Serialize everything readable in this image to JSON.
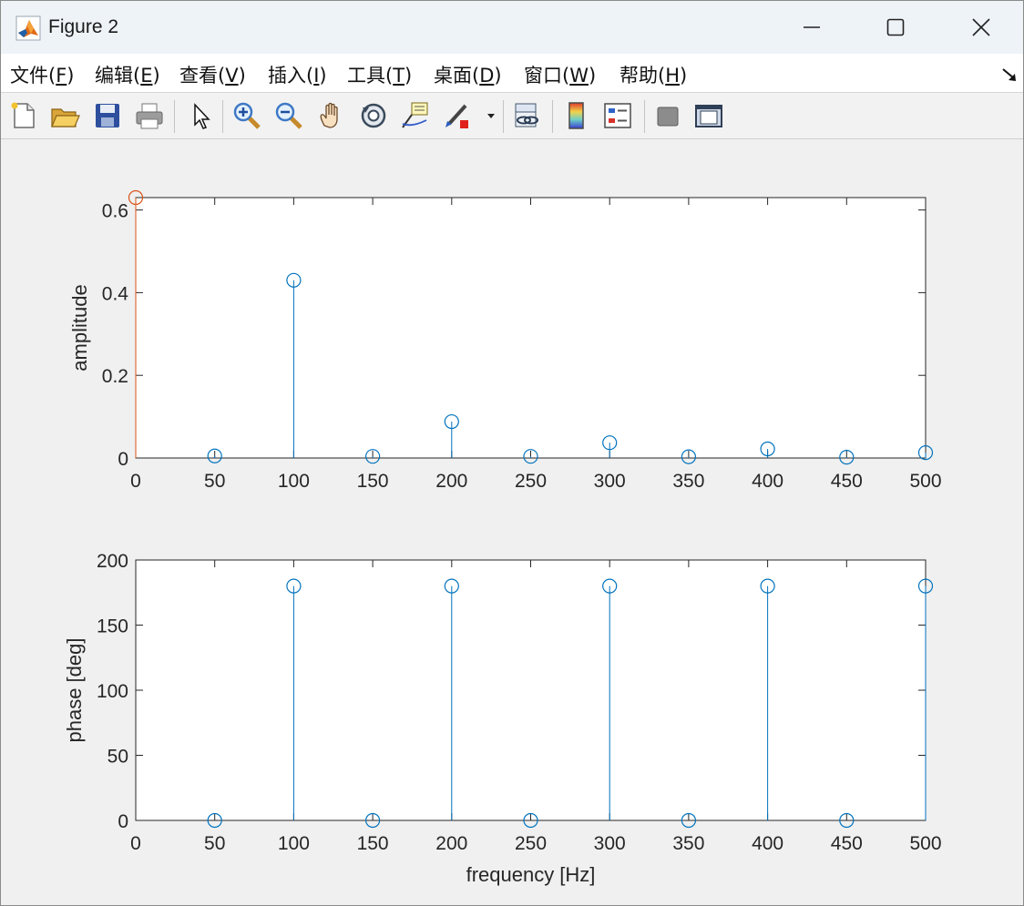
{
  "window": {
    "title": "Figure 2",
    "app_icon": "matlab-logo-icon",
    "controls": [
      "minimize-icon",
      "maximize-icon",
      "close-icon"
    ]
  },
  "menu": [
    {
      "label": "文件(",
      "mnemonic": "F",
      "suffix": ")"
    },
    {
      "label": "编辑(",
      "mnemonic": "E",
      "suffix": ")"
    },
    {
      "label": "查看(",
      "mnemonic": "V",
      "suffix": ")"
    },
    {
      "label": "插入(",
      "mnemonic": "I",
      "suffix": ")"
    },
    {
      "label": "工具(",
      "mnemonic": "T",
      "suffix": ")"
    },
    {
      "label": "桌面(",
      "mnemonic": "D",
      "suffix": ")"
    },
    {
      "label": "窗口(",
      "mnemonic": "W",
      "suffix": ")"
    },
    {
      "label": "帮助(",
      "mnemonic": "H",
      "suffix": ")"
    }
  ],
  "toolbar": [
    "new-figure-icon",
    "open-file-icon",
    "save-icon",
    "print-icon",
    "edit-plot-pointer-icon",
    "zoom-in-icon",
    "zoom-out-icon",
    "pan-hand-icon",
    "rotate-3d-icon",
    "data-cursor-icon",
    "brush-icon",
    "brush-dropdown-icon",
    "link-plot-icon",
    "insert-colorbar-icon",
    "insert-legend-icon",
    "hide-plot-tools-icon",
    "show-plot-tools-icon"
  ],
  "colors": {
    "stem_blue": "#0072BD",
    "stem_orange": "#D95319",
    "axes_bg": "#ffffff",
    "figure_bg": "#f0f0f0"
  },
  "chart_data": [
    {
      "type": "stem",
      "title": "",
      "xlabel": "",
      "ylabel": "amplitude",
      "xlim": [
        0,
        500
      ],
      "ylim": [
        0,
        0.63
      ],
      "xticks": [
        "0",
        "50",
        "100",
        "150",
        "200",
        "250",
        "300",
        "350",
        "400",
        "450",
        "500"
      ],
      "yticks": [
        "0",
        "0.2",
        "0.4",
        "0.6"
      ],
      "series": [
        {
          "color": "#D95319",
          "x": [
            0
          ],
          "y": [
            0.63
          ]
        },
        {
          "color": "#0072BD",
          "x": [
            50,
            100,
            150,
            200,
            250,
            300,
            350,
            400,
            450,
            500
          ],
          "y": [
            0.005,
            0.43,
            0.004,
            0.088,
            0.004,
            0.037,
            0.003,
            0.022,
            0.002,
            0.013
          ]
        }
      ]
    },
    {
      "type": "stem",
      "title": "",
      "xlabel": "frequency [Hz]",
      "ylabel": "phase [deg]",
      "xlim": [
        0,
        500
      ],
      "ylim": [
        0,
        200
      ],
      "xticks": [
        "0",
        "50",
        "100",
        "150",
        "200",
        "250",
        "300",
        "350",
        "400",
        "450",
        "500"
      ],
      "yticks": [
        "0",
        "50",
        "100",
        "150",
        "200"
      ],
      "series": [
        {
          "color": "#0072BD",
          "x": [
            50,
            100,
            150,
            200,
            250,
            300,
            350,
            400,
            450,
            500
          ],
          "y": [
            0,
            180,
            0,
            180,
            0,
            180,
            0,
            180,
            0,
            180
          ]
        }
      ]
    }
  ]
}
